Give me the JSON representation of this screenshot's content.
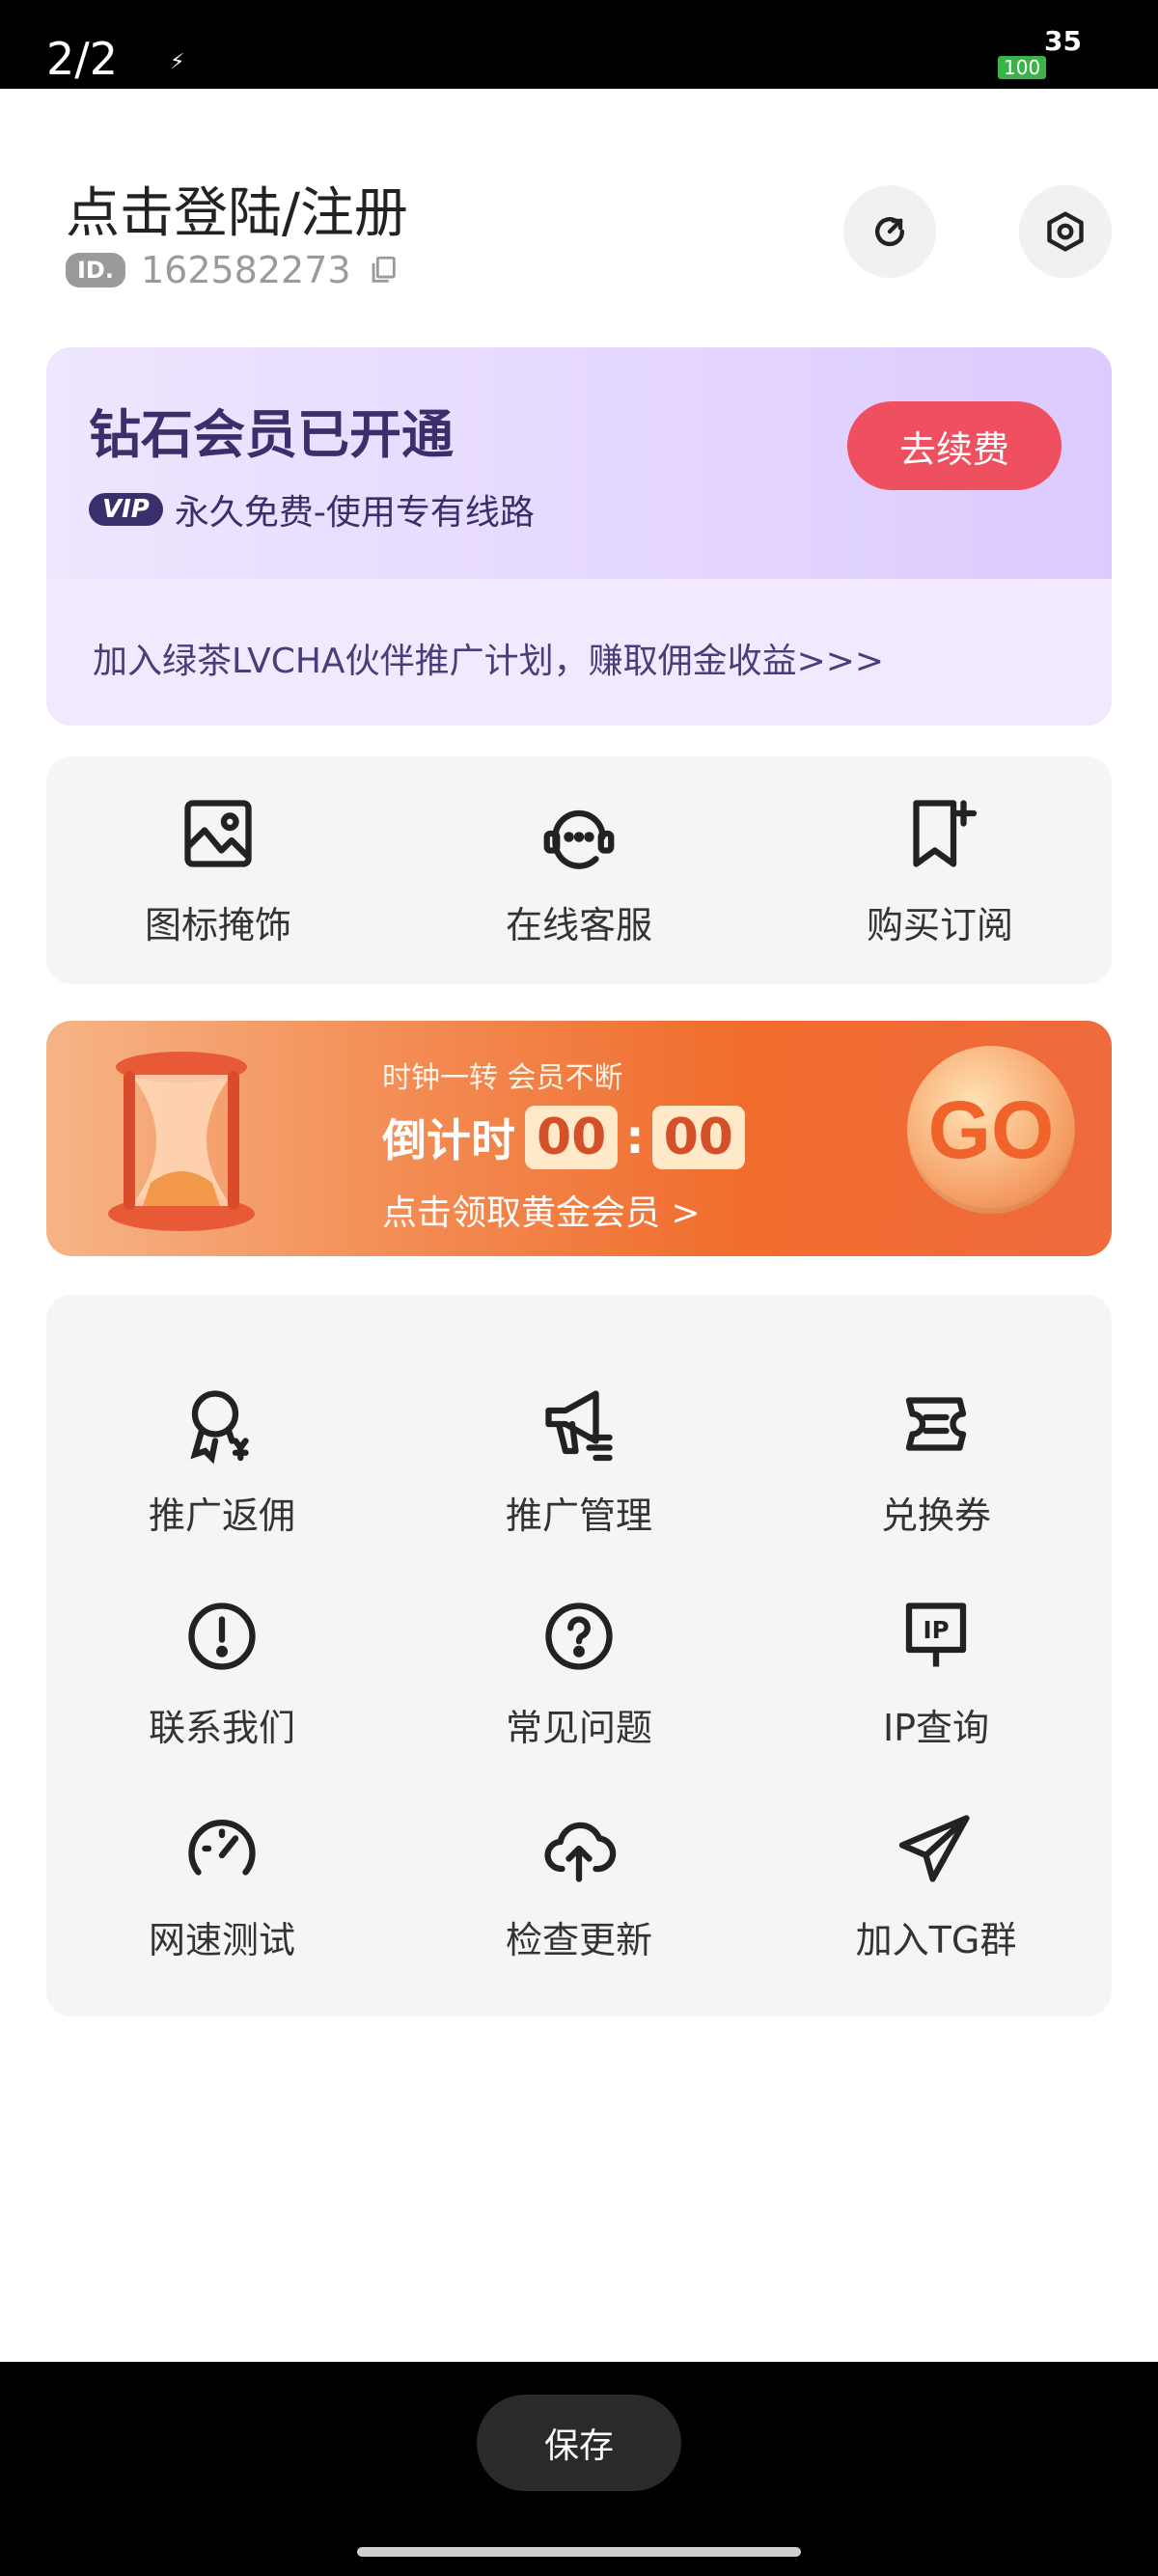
{
  "status_bar": {
    "pager": "2/2",
    "clock": "35",
    "battery": "100"
  },
  "header": {
    "title": "点击登陆/注册",
    "id_badge": "ID.",
    "id_value": "162582273"
  },
  "vip": {
    "title": "钻石会员已开通",
    "badge": "VIP",
    "subtitle": "永久免费-使用专有线路",
    "renew_label": "去续费",
    "promo_text": "加入绿茶LVCHA伙伴推广计划，赚取佣金收益>>>"
  },
  "shortcuts": [
    {
      "label": "图标掩饰",
      "icon": "image-icon"
    },
    {
      "label": "在线客服",
      "icon": "headset-icon"
    },
    {
      "label": "购买订阅",
      "icon": "bookmark-plus-icon"
    }
  ],
  "banner": {
    "subtitle": "时钟一转 会员不断",
    "countdown_label": "倒计时",
    "minutes": "00",
    "seconds": "00",
    "claim_text": "点击领取黄金会员 >",
    "go_label": "GO"
  },
  "menu": {
    "items": [
      {
        "label": "推广返佣",
        "icon": "award-yuan-icon"
      },
      {
        "label": "推广管理",
        "icon": "megaphone-icon"
      },
      {
        "label": "兑换券",
        "icon": "ticket-icon"
      },
      {
        "label": "联系我们",
        "icon": "alert-circle-icon"
      },
      {
        "label": "常见问题",
        "icon": "help-circle-icon"
      },
      {
        "label": "IP查询",
        "icon": "ip-sign-icon"
      },
      {
        "label": "网速测试",
        "icon": "speedometer-icon"
      },
      {
        "label": "检查更新",
        "icon": "cloud-upload-icon"
      },
      {
        "label": "加入TG群",
        "icon": "telegram-icon"
      }
    ]
  },
  "footer": {
    "save_label": "保存"
  }
}
